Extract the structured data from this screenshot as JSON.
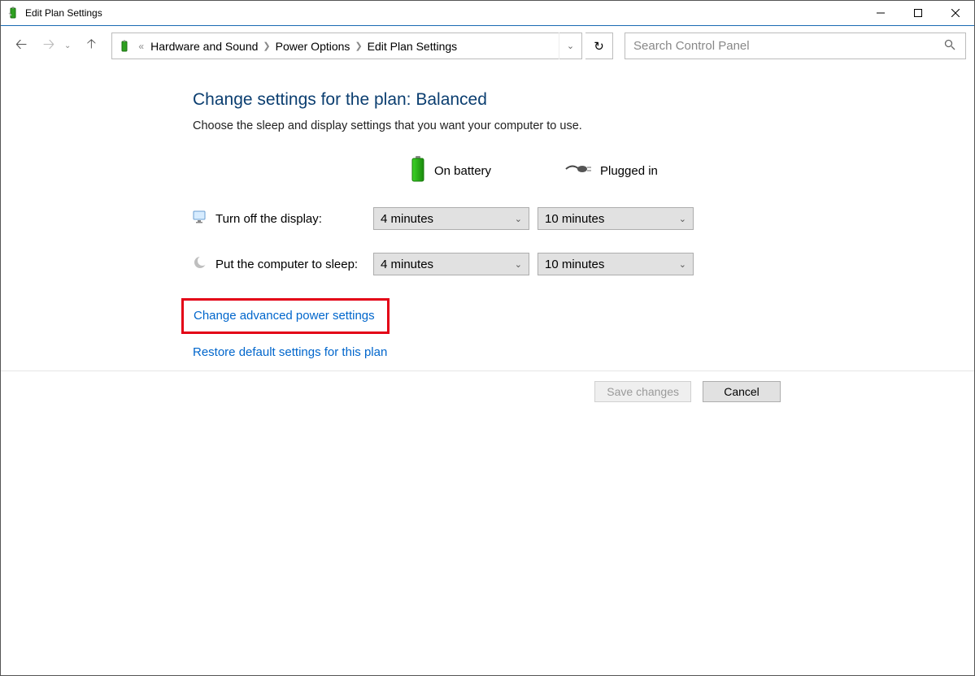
{
  "window": {
    "title": "Edit Plan Settings"
  },
  "breadcrumbs": {
    "item1": "Hardware and Sound",
    "item2": "Power Options",
    "item3": "Edit Plan Settings"
  },
  "search": {
    "placeholder": "Search Control Panel"
  },
  "page": {
    "heading": "Change settings for the plan: Balanced",
    "sub": "Choose the sleep and display settings that you want your computer to use."
  },
  "columns": {
    "battery": "On battery",
    "plugged": "Plugged in"
  },
  "settings": {
    "display": {
      "label": "Turn off the display:",
      "battery": "4 minutes",
      "plugged": "10 minutes"
    },
    "sleep": {
      "label": "Put the computer to sleep:",
      "battery": "4 minutes",
      "plugged": "10 minutes"
    }
  },
  "links": {
    "advanced": "Change advanced power settings",
    "restore": "Restore default settings for this plan"
  },
  "buttons": {
    "save": "Save changes",
    "cancel": "Cancel"
  }
}
